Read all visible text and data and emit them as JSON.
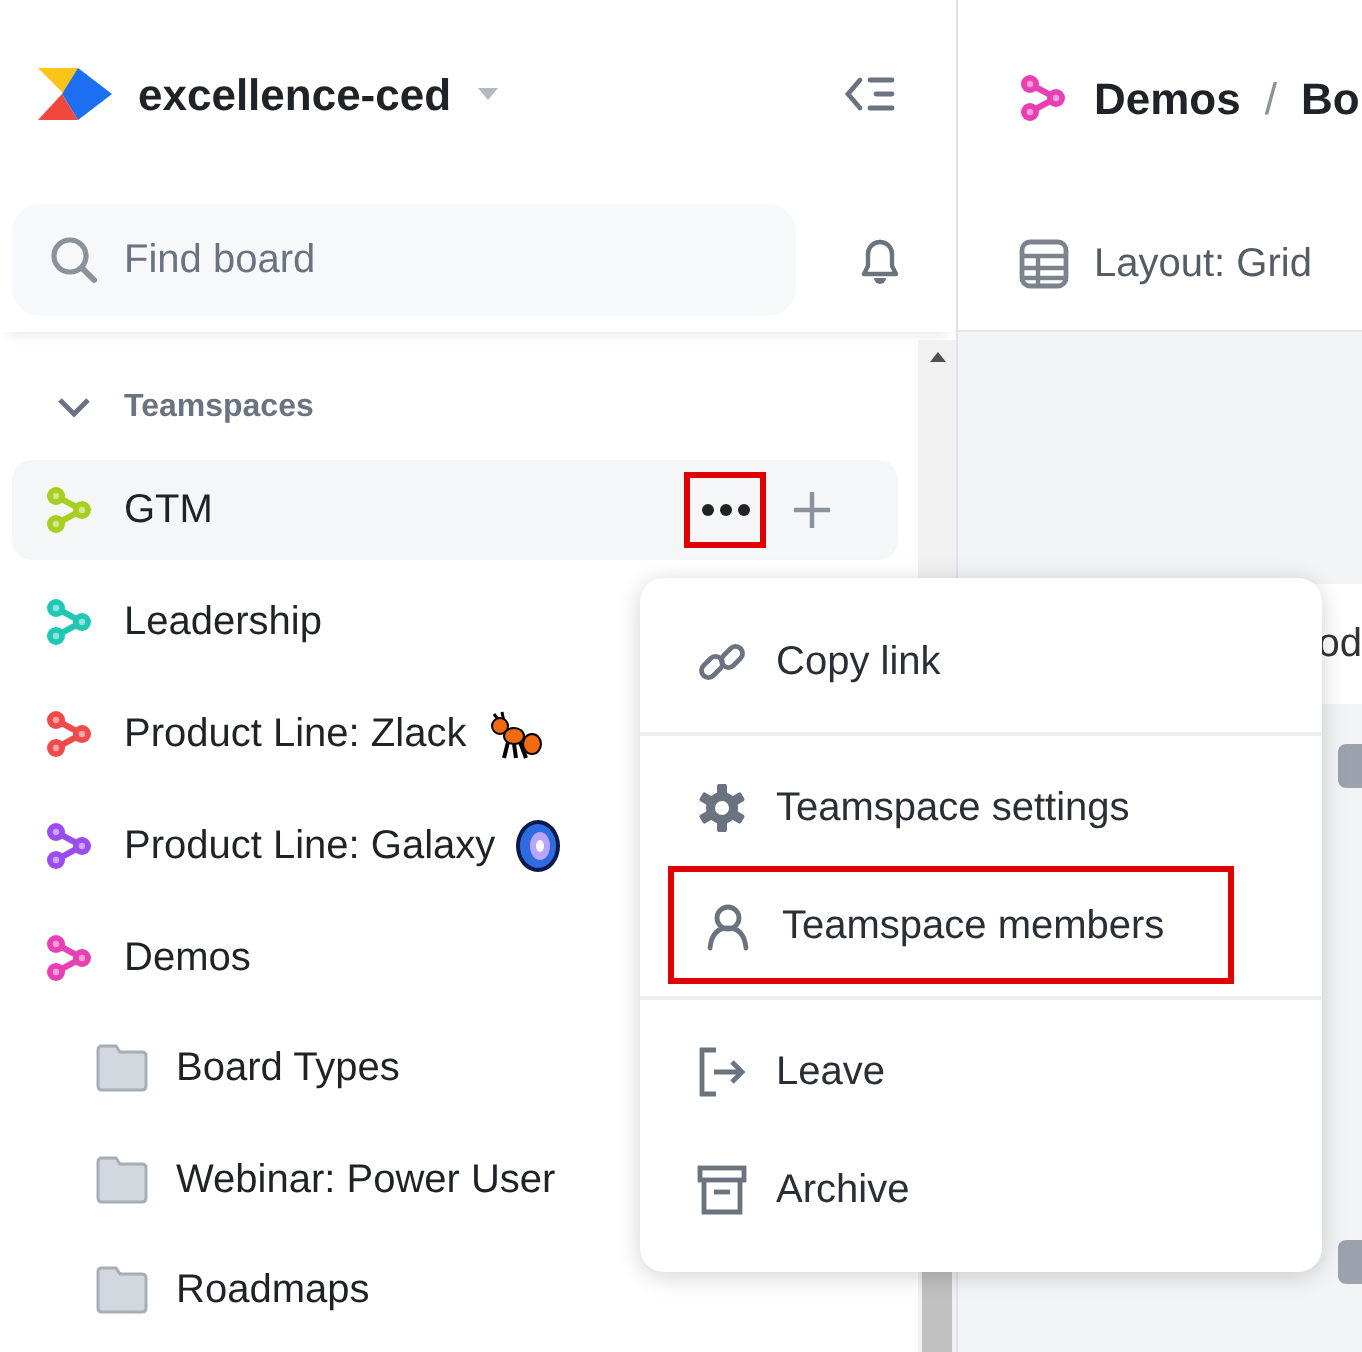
{
  "workspace": {
    "name": "excellence-ced"
  },
  "search": {
    "placeholder": "Find board"
  },
  "sidebar": {
    "section": {
      "label": "Teamspaces",
      "expanded": true
    },
    "teamspaces": [
      {
        "label": "GTM",
        "color": "#a6cf1f",
        "selected": true,
        "kind": "plain"
      },
      {
        "label": "Leadership",
        "color": "#1fc8b4",
        "selected": false,
        "kind": "plain"
      },
      {
        "label": "Product Line: Zlack",
        "color": "#f04a4a",
        "selected": false,
        "kind": "ant"
      },
      {
        "label": "Product Line: Galaxy",
        "color": "#9a4cf0",
        "selected": false,
        "kind": "galaxy"
      },
      {
        "label": "Demos",
        "color": "#e83fb5",
        "selected": false,
        "kind": "plain",
        "children": [
          {
            "label": "Board Types"
          },
          {
            "label": "Webinar: Power User"
          },
          {
            "label": "Roadmaps"
          }
        ]
      }
    ]
  },
  "more_button": {
    "highlighted": true
  },
  "header": {
    "breadcrumb": [
      {
        "label": "Demos",
        "color": "#e83fb5"
      },
      {
        "label": "Bo"
      }
    ],
    "separator": "/",
    "layout": "Layout: Grid",
    "partial_text": "od"
  },
  "menu": {
    "groups": [
      [
        {
          "label": "Copy link",
          "kind": "link",
          "highlighted": false
        }
      ],
      [
        {
          "label": "Teamspace settings",
          "kind": "gear",
          "highlighted": false
        },
        {
          "label": "Teamspace members",
          "kind": "person",
          "highlighted": true
        }
      ],
      [
        {
          "label": "Leave",
          "kind": "exit",
          "highlighted": false
        },
        {
          "label": "Archive",
          "kind": "archive",
          "highlighted": false
        }
      ]
    ]
  }
}
